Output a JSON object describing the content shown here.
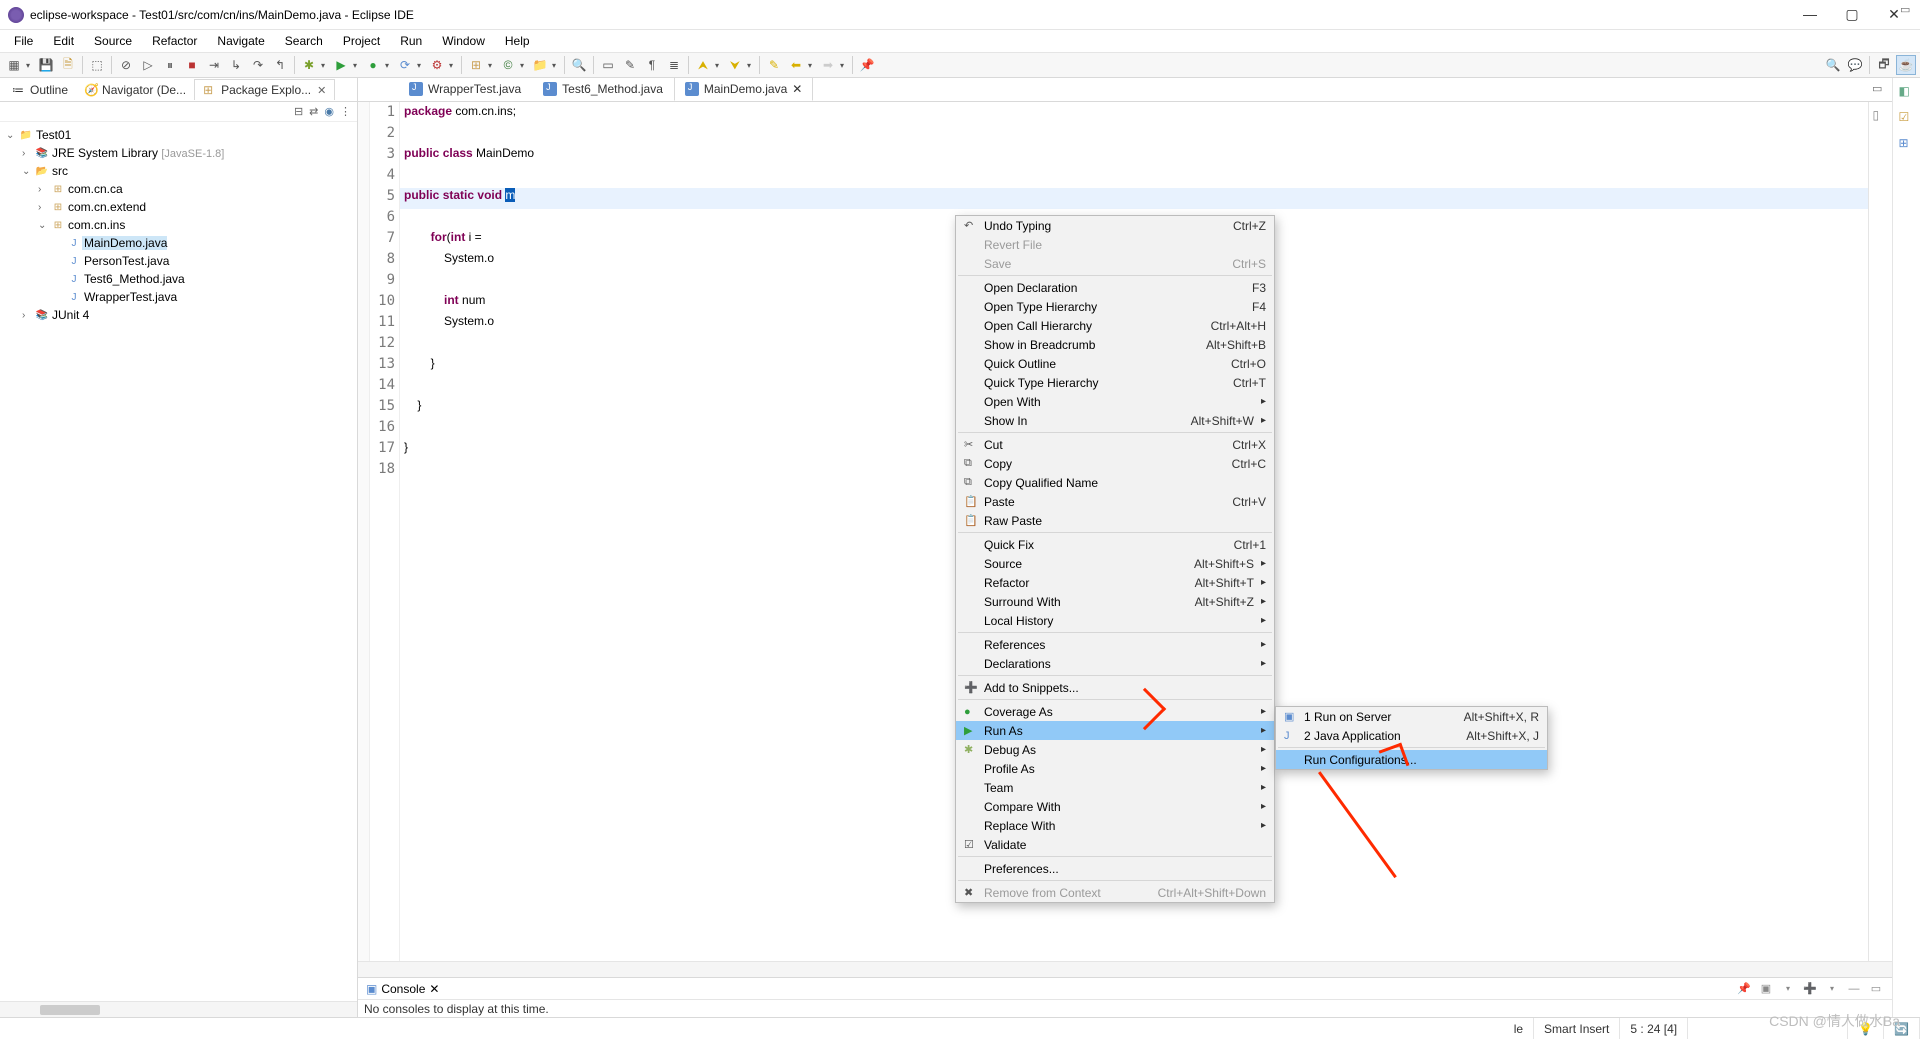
{
  "window": {
    "title": "eclipse-workspace - Test01/src/com/cn/ins/MainDemo.java - Eclipse IDE"
  },
  "menubar": [
    "File",
    "Edit",
    "Source",
    "Refactor",
    "Navigate",
    "Search",
    "Project",
    "Run",
    "Window",
    "Help"
  ],
  "left": {
    "tabs": {
      "outline": "Outline",
      "navigator": "Navigator (De...",
      "package_explorer": "Package Explo..."
    },
    "tree": {
      "project": "Test01",
      "jre": "JRE System Library",
      "jre_hint": "[JavaSE-1.8]",
      "src": "src",
      "pkg_ca": "com.cn.ca",
      "pkg_extend": "com.cn.extend",
      "pkg_ins": "com.cn.ins",
      "file_main": "MainDemo.java",
      "file_person": "PersonTest.java",
      "file_t6": "Test6_Method.java",
      "file_wrap": "WrapperTest.java",
      "junit": "JUnit 4"
    }
  },
  "editor": {
    "tabs": {
      "wrapper": "WrapperTest.java",
      "test6": "Test6_Method.java",
      "main": "MainDemo.java"
    },
    "code": {
      "l1a": "package",
      "l1b": " com.cn.ins;",
      "l3a": "public",
      "l3b": " ",
      "l3c": "class",
      "l3d": " MainDemo",
      "l5a": "public",
      "l5b": " ",
      "l5c": "static",
      "l5d": " ",
      "l5e": "void",
      "l5f": " ",
      "l5g": "m",
      "l7a": "        ",
      "l7b": "for",
      "l7c": "(",
      "l7d": "int",
      "l7e": " i = ",
      "l8": "            System.o",
      "l10a": "            ",
      "l10b": "int",
      "l10c": " num ",
      "l11": "            System.o",
      "l13": "        }",
      "l15": "    }",
      "l17": "}"
    }
  },
  "context_menu": [
    {
      "icon": "↶",
      "label": "Undo Typing",
      "key": "Ctrl+Z"
    },
    {
      "label": "Revert File",
      "disabled": true
    },
    {
      "label": "Save",
      "key": "Ctrl+S",
      "disabled": true
    },
    {
      "sep": true
    },
    {
      "label": "Open Declaration",
      "key": "F3"
    },
    {
      "label": "Open Type Hierarchy",
      "key": "F4"
    },
    {
      "label": "Open Call Hierarchy",
      "key": "Ctrl+Alt+H"
    },
    {
      "label": "Show in Breadcrumb",
      "key": "Alt+Shift+B"
    },
    {
      "label": "Quick Outline",
      "key": "Ctrl+O"
    },
    {
      "label": "Quick Type Hierarchy",
      "key": "Ctrl+T"
    },
    {
      "label": "Open With",
      "sub": true
    },
    {
      "label": "Show In",
      "key": "Alt+Shift+W",
      "sub": true
    },
    {
      "sep": true
    },
    {
      "icon": "✂",
      "label": "Cut",
      "key": "Ctrl+X"
    },
    {
      "icon": "⧉",
      "label": "Copy",
      "key": "Ctrl+C"
    },
    {
      "icon": "⧉",
      "label": "Copy Qualified Name"
    },
    {
      "icon": "📋",
      "label": "Paste",
      "key": "Ctrl+V"
    },
    {
      "icon": "📋",
      "label": "Raw Paste"
    },
    {
      "sep": true
    },
    {
      "label": "Quick Fix",
      "key": "Ctrl+1"
    },
    {
      "label": "Source",
      "key": "Alt+Shift+S",
      "sub": true
    },
    {
      "label": "Refactor",
      "key": "Alt+Shift+T",
      "sub": true
    },
    {
      "label": "Surround With",
      "key": "Alt+Shift+Z",
      "sub": true
    },
    {
      "label": "Local History",
      "sub": true
    },
    {
      "sep": true
    },
    {
      "label": "References",
      "sub": true
    },
    {
      "label": "Declarations",
      "sub": true
    },
    {
      "sep": true
    },
    {
      "icon": "➕",
      "label": "Add to Snippets..."
    },
    {
      "sep": true
    },
    {
      "icon": "●",
      "iconColor": "#2e9e3b",
      "label": "Coverage As",
      "sub": true
    },
    {
      "icon": "▶",
      "iconColor": "#2e9e3b",
      "label": "Run As",
      "sub": true,
      "hl": true
    },
    {
      "icon": "✱",
      "iconColor": "#8fb060",
      "label": "Debug As",
      "sub": true
    },
    {
      "label": "Profile As",
      "sub": true
    },
    {
      "label": "Team",
      "sub": true
    },
    {
      "label": "Compare With",
      "sub": true
    },
    {
      "label": "Replace With",
      "sub": true
    },
    {
      "icon": "☑",
      "label": "Validate"
    },
    {
      "sep": true
    },
    {
      "label": "Preferences..."
    },
    {
      "sep": true
    },
    {
      "icon": "✖",
      "label": "Remove from Context",
      "key": "Ctrl+Alt+Shift+Down",
      "disabled": true
    }
  ],
  "submenu": {
    "items": [
      {
        "icon": "▣",
        "label": "1 Run on Server",
        "key": "Alt+Shift+X, R"
      },
      {
        "icon": "J",
        "label": "2 Java Application",
        "key": "Alt+Shift+X, J"
      }
    ],
    "run_config": "Run Configurations..."
  },
  "console": {
    "tab": "Console",
    "message": "No consoles to display at this time."
  },
  "status": {
    "insert": "Smart Insert",
    "pos": "5 : 24 [4]"
  },
  "watermark": "CSDN @情人做水Ba"
}
